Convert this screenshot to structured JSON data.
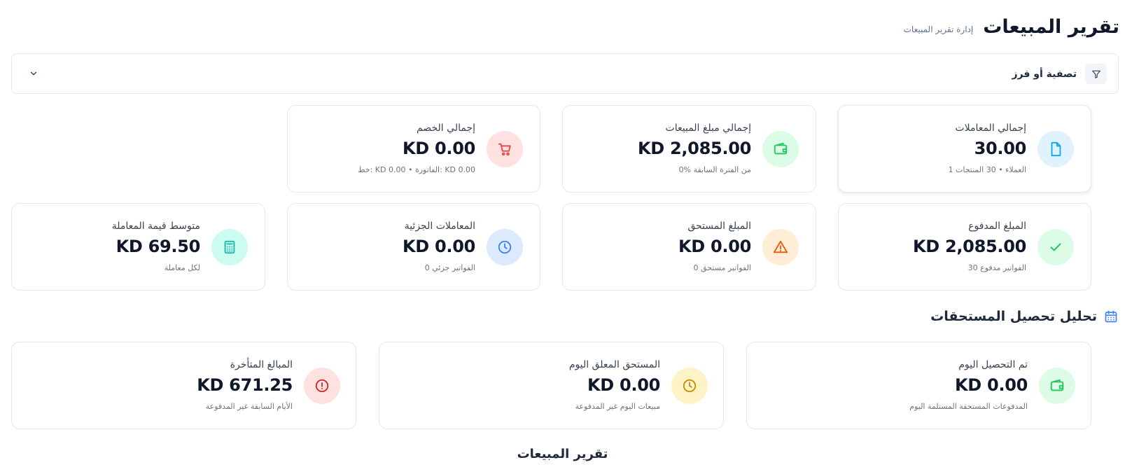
{
  "header": {
    "title": "تقرير المبيعات",
    "subtitle": "إدارة تقرير المبيعات"
  },
  "filter": {
    "label": "تصفية أو فرز",
    "icon": "filter-icon",
    "toggle_icon": "chevron-down-icon"
  },
  "stats": [
    {
      "label": "إجمالي المعاملات",
      "value": "30.00",
      "sub": "1 العملاء • 30 المنتجات",
      "icon": "file-icon",
      "icon_color": "#0ea5e9",
      "icon_bg": "#e0f2fe"
    },
    {
      "label": "إجمالي مبلغ المبيعات",
      "value": "KD 2,085.00",
      "sub": "0% من الفترة السابقة",
      "icon": "wallet-icon",
      "icon_color": "#22c55e",
      "icon_bg": "#dcfce7"
    },
    {
      "label": "إجمالي الخصم",
      "value": "KD 0.00",
      "sub": "خط: KD 0.00 • الفاتورة: KD 0.00",
      "icon": "cart-icon",
      "icon_color": "#ef4444",
      "icon_bg": "#fee2e2"
    },
    {
      "label": "المبلغ المدفوع",
      "value": "KD 2,085.00",
      "sub": "30 الفواتير مدفوع",
      "icon": "check-icon",
      "icon_color": "#22c55e",
      "icon_bg": "#dcfce7"
    },
    {
      "label": "المبلغ المستحق",
      "value": "KD 0.00",
      "sub": "0 الفواتير مستحق",
      "icon": "warning-icon",
      "icon_color": "#ea580c",
      "icon_bg": "#ffedd5"
    },
    {
      "label": "المعاملات الجزئية",
      "value": "KD 0.00",
      "sub": "0 الفواتير جزئي",
      "icon": "clock-icon",
      "icon_color": "#3b82f6",
      "icon_bg": "#dbeafe"
    },
    {
      "label": "متوسط قيمة المعاملة",
      "value": "KD 69.50",
      "sub": "لكل معاملة",
      "icon": "calculator-icon",
      "icon_color": "#14b8a6",
      "icon_bg": "#ccfbf1"
    }
  ],
  "collections": {
    "title": "تحليل تحصيل المستحقات",
    "icon": "calendar-icon",
    "cards": [
      {
        "label": "تم التحصيل اليوم",
        "value": "KD 0.00",
        "sub": "المدفوعات المستحقة المستلمة اليوم",
        "icon": "wallet-icon",
        "icon_color": "#22c55e",
        "icon_bg": "#dcfce7"
      },
      {
        "label": "المستحق المعلق اليوم",
        "value": "KD 0.00",
        "sub": "مبيعات اليوم غير المدفوعة",
        "icon": "clock-icon",
        "icon_color": "#ca8a04",
        "icon_bg": "#fef3c7"
      },
      {
        "label": "المبالغ المتأخرة",
        "value": "KD 671.25",
        "sub": "الأيام السابقة غير المدفوعة",
        "icon": "alert-circle-icon",
        "icon_color": "#dc2626",
        "icon_bg": "#fee2e2"
      }
    ]
  },
  "report": {
    "title": "تقرير المبيعات"
  }
}
